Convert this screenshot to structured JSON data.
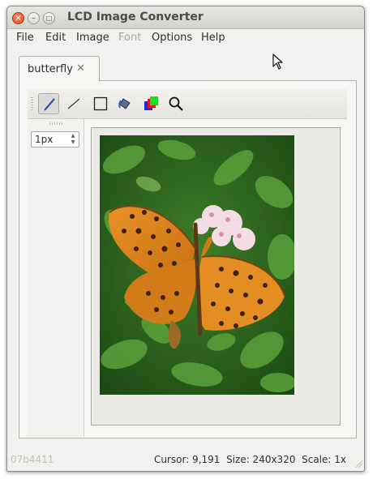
{
  "window": {
    "title": "LCD Image Converter"
  },
  "menu": [
    {
      "label": "File",
      "enabled": true
    },
    {
      "label": "Edit",
      "enabled": true
    },
    {
      "label": "Image",
      "enabled": true
    },
    {
      "label": "Font",
      "enabled": false
    },
    {
      "label": "Options",
      "enabled": true
    },
    {
      "label": "Help",
      "enabled": true
    }
  ],
  "tabs": [
    {
      "label": "butterfly",
      "close_icon": "close-x-icon"
    }
  ],
  "toolbar": {
    "tools": [
      {
        "name": "pen-icon",
        "active": true
      },
      {
        "name": "line-icon",
        "active": false
      },
      {
        "name": "rectangle-icon",
        "active": false
      },
      {
        "name": "fill-bucket-icon",
        "active": false
      },
      {
        "name": "color-swap-icon",
        "active": false
      },
      {
        "name": "zoom-icon",
        "active": false
      }
    ]
  },
  "sidebar": {
    "line_width_value": "1px"
  },
  "image": {
    "subject": "butterfly photo",
    "colors": {
      "foliage": "#2f6a1f",
      "wing": "#e08a1e",
      "flower": "#f3dce3"
    }
  },
  "statusbar": {
    "version": "07b4411",
    "cursor": "Cursor: 9,191",
    "size": "Size: 240x320",
    "scale": "Scale: 1x"
  }
}
